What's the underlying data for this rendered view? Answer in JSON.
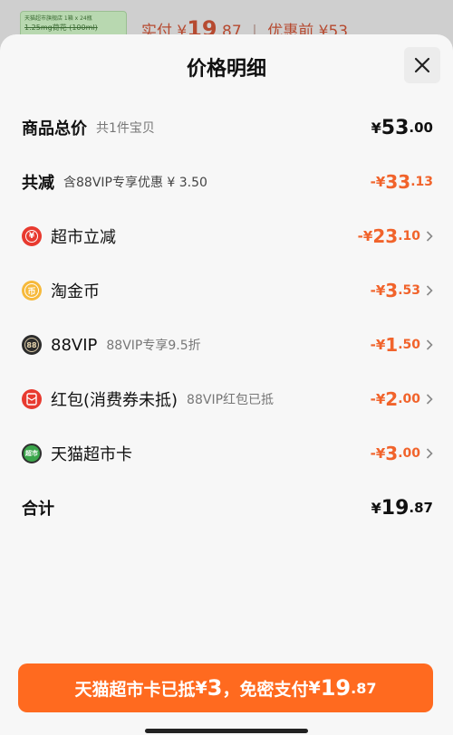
{
  "background": {
    "thumb_line1": "天猫超市旗舰店 1箱 x 24瓶",
    "thumb_line2": "1.25mg荷花 (100ml)",
    "actual_label": "实付",
    "actual_currency": "¥",
    "actual_int": "19",
    "actual_dec": ".87",
    "separator": "|",
    "before_label": "优惠前",
    "before_amount": "¥53"
  },
  "sheet": {
    "title": "价格明细",
    "close_icon": "close-icon"
  },
  "rows": [
    {
      "label": "商品总价",
      "sub": "共1件宝贝",
      "currency": "¥",
      "int": "53",
      "dec": ".00"
    },
    {
      "label": "共减",
      "sub": "含88VIP专享优惠 ¥ 3.50",
      "currency": "-¥",
      "int": "33",
      "dec": ".13"
    },
    {
      "label": "超市立减",
      "sub": "",
      "currency": "-¥",
      "int": "23",
      "dec": ".10",
      "icon": "supermarket-discount-icon"
    },
    {
      "label": "淘金币",
      "sub": "",
      "currency": "-¥",
      "int": "3",
      "dec": ".53",
      "icon": "coin-icon"
    },
    {
      "label": "88VIP",
      "sub": "88VIP专享9.5折",
      "currency": "-¥",
      "int": "1",
      "dec": ".50",
      "icon": "vip-88-icon"
    },
    {
      "label": "红包(消费券未抵)",
      "sub": "88VIP红包已抵",
      "currency": "-¥",
      "int": "2",
      "dec": ".00",
      "icon": "red-packet-icon"
    },
    {
      "label": "天猫超市卡",
      "sub": "",
      "currency": "-¥",
      "int": "3",
      "dec": ".00",
      "icon": "tmall-card-icon"
    },
    {
      "label": "合计",
      "sub": "",
      "currency": "¥",
      "int": "19",
      "dec": ".87"
    }
  ],
  "icons": {
    "supermarket_glyph": "¥",
    "coin_glyph": "币",
    "vip_glyph": "88",
    "card_glyph": "超市"
  },
  "pay_button": {
    "prefix": "天猫超市卡已抵",
    "card_currency": "¥",
    "card_amount": "3",
    "middle": "，免密支付",
    "currency": "¥",
    "int": "19",
    "dec": ".87"
  },
  "colors": {
    "accent": "#ff6a1f",
    "discount_text": "#f1632b"
  }
}
